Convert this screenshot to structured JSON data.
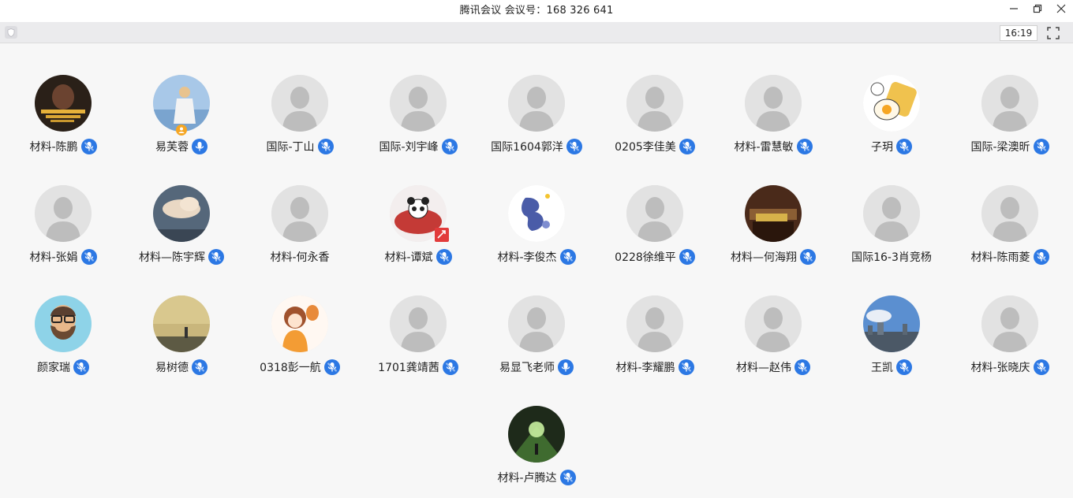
{
  "window": {
    "title": "腾讯会议 会议号：168 326 641",
    "minimize_icon": "minimize-icon",
    "restore_icon": "restore-icon",
    "close_icon": "close-icon"
  },
  "toolbar": {
    "timer": "16:19",
    "shield_icon": "shield-icon",
    "fullscreen_icon": "fullscreen-icon"
  },
  "colors": {
    "mic_blue": "#2c78e4",
    "placeholder_bg": "#e2e2e2",
    "placeholder_fg": "#bdbdbd"
  },
  "participants": [
    {
      "name": "材料-陈鹏",
      "mic": "muted",
      "avatar": "photo"
    },
    {
      "name": "易芙蓉",
      "mic": "active",
      "avatar": "photo"
    },
    {
      "name": "国际-丁山",
      "mic": "muted",
      "avatar": "default"
    },
    {
      "name": "国际-刘宇峰",
      "mic": "muted",
      "avatar": "default"
    },
    {
      "name": "国际1604郭洋",
      "mic": "muted",
      "avatar": "default"
    },
    {
      "name": "0205李佳美",
      "mic": "muted",
      "avatar": "default"
    },
    {
      "name": "材料-雷慧敏",
      "mic": "muted",
      "avatar": "default"
    },
    {
      "name": "子玥",
      "mic": "muted",
      "avatar": "photo"
    },
    {
      "name": "国际-梁澳昕",
      "mic": "muted",
      "avatar": "default"
    },
    {
      "name": "材料-张娟",
      "mic": "muted",
      "avatar": "default"
    },
    {
      "name": "材料—陈宇辉",
      "mic": "muted",
      "avatar": "photo"
    },
    {
      "name": "材料-何永香",
      "mic": "none",
      "avatar": "default"
    },
    {
      "name": "材料-谭斌",
      "mic": "muted",
      "avatar": "photo"
    },
    {
      "name": "材料-李俊杰",
      "mic": "muted",
      "avatar": "photo"
    },
    {
      "name": "0228徐维平",
      "mic": "muted",
      "avatar": "default"
    },
    {
      "name": "材料—何海翔",
      "mic": "muted",
      "avatar": "photo"
    },
    {
      "name": "国际16-3肖竞杨",
      "mic": "none",
      "avatar": "default"
    },
    {
      "name": "材料-陈雨菱",
      "mic": "muted",
      "avatar": "default"
    },
    {
      "name": "颜家瑞",
      "mic": "muted",
      "avatar": "photo"
    },
    {
      "name": "易树德",
      "mic": "muted",
      "avatar": "photo"
    },
    {
      "name": "0318彭一航",
      "mic": "muted",
      "avatar": "photo"
    },
    {
      "name": "1701龚靖茜",
      "mic": "muted",
      "avatar": "default"
    },
    {
      "name": "易显飞老师",
      "mic": "active",
      "avatar": "default"
    },
    {
      "name": "材料-李耀鹏",
      "mic": "muted",
      "avatar": "default"
    },
    {
      "name": "材料—赵伟",
      "mic": "muted",
      "avatar": "default"
    },
    {
      "name": "王凯",
      "mic": "muted",
      "avatar": "photo"
    },
    {
      "name": "材料-张晓庆",
      "mic": "muted",
      "avatar": "default"
    },
    {
      "name": "材料-卢腾达",
      "mic": "muted",
      "avatar": "photo"
    }
  ]
}
